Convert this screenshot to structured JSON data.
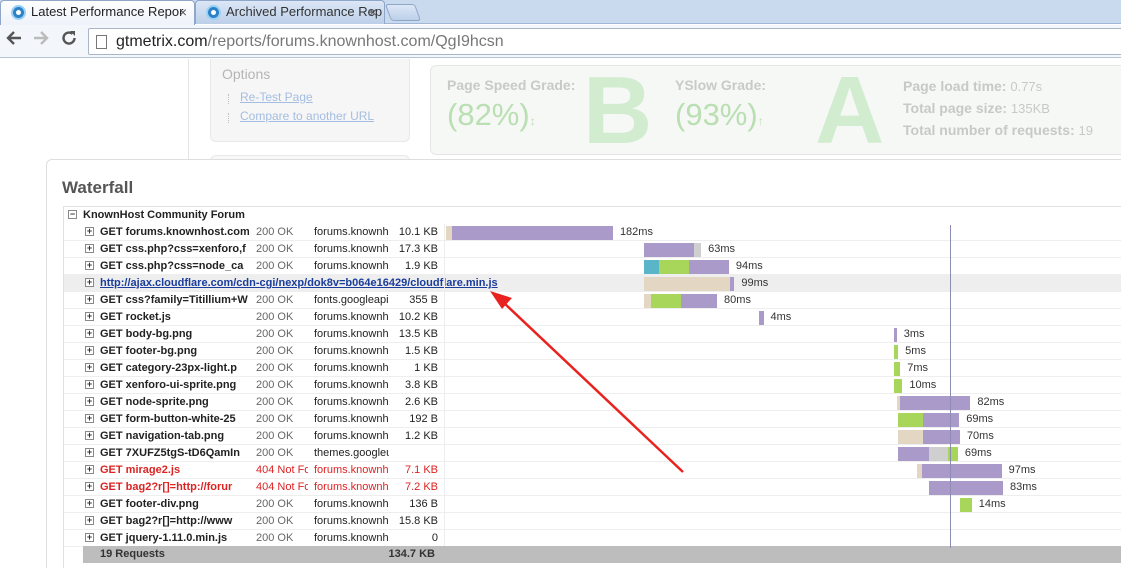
{
  "browser": {
    "tabs": [
      {
        "title": "Latest Performance Repor",
        "close": "×"
      },
      {
        "title": "Archived Performance Rep",
        "close": "×"
      }
    ],
    "url_domain": "gtmetrix.com",
    "url_path": "/reports/forums.knownhost.com/QgI9hcsn"
  },
  "options": {
    "title": "Options",
    "links": [
      "Re-Test Page",
      "Compare to another URL"
    ]
  },
  "grades": {
    "pagespeed": {
      "label": "Page Speed Grade:",
      "percent": "(82%)",
      "arrow": "↕",
      "letter": "B"
    },
    "yslow": {
      "label": "YSlow Grade:",
      "percent": "(93%)",
      "arrow": "↑",
      "letter": "A"
    },
    "stats": [
      {
        "label": "Page load time:",
        "value": "0.77s"
      },
      {
        "label": "Total page size:",
        "value": "135KB"
      },
      {
        "label": "Total number of requests:",
        "value": "19"
      }
    ]
  },
  "waterfall": {
    "title": "Waterfall",
    "group_label": "KnownHost Community Forum",
    "group_toggle": "−",
    "row_toggle": "+",
    "rows": [
      {
        "url": "GET forums.knownhost.com",
        "status": "200 OK",
        "domain": "forums.knownh",
        "size": "10.1 KB",
        "time": "182ms",
        "start": 0.001,
        "segs": [
          {
            "w": 0.009,
            "c": "#e3d7c4"
          },
          {
            "w": 0.232,
            "c": "#a99ac9"
          }
        ]
      },
      {
        "url": "GET css.php?css=xenforo,f",
        "status": "200 OK",
        "domain": "forums.knownh",
        "size": "17.3 KB",
        "time": "63ms",
        "start": 0.287,
        "segs": [
          {
            "w": 0.072,
            "c": "#a99ac9"
          },
          {
            "w": 0.01,
            "c": "#cfcfcf"
          }
        ]
      },
      {
        "url": "GET css.php?css=node_ca",
        "status": "200 OK",
        "domain": "forums.knownh",
        "size": "1.9 KB",
        "time": "94ms",
        "start": 0.287,
        "segs": [
          {
            "w": 0.021,
            "c": "#5ab5c9"
          },
          {
            "w": 0.043,
            "c": "#a8d65a"
          },
          {
            "w": 0.058,
            "c": "#a99ac9"
          }
        ]
      },
      {
        "url": "http://ajax.cloudflare.com/cdn-cgi/nexp/dok8v=b064e16429/cloudflare.min.js",
        "status": "",
        "domain": "",
        "size": "",
        "time": "99ms",
        "start": 0.287,
        "link": true,
        "highlight": true,
        "segs": [
          {
            "w": 0.124,
            "c": "#e3d7c4"
          },
          {
            "w": 0.006,
            "c": "#a99ac9"
          }
        ]
      },
      {
        "url": "GET css?family=Titillium+W",
        "status": "200 OK",
        "domain": "fonts.googleapi",
        "size": "355 B",
        "time": "80ms",
        "start": 0.287,
        "segs": [
          {
            "w": 0.01,
            "c": "#e3d7c4"
          },
          {
            "w": 0.043,
            "c": "#a8d65a"
          },
          {
            "w": 0.052,
            "c": "#a99ac9"
          }
        ]
      },
      {
        "url": "GET rocket.js",
        "status": "200 OK",
        "domain": "forums.knownh",
        "size": "10.2 KB",
        "time": "4ms",
        "start": 0.453,
        "segs": [
          {
            "w": 0.006,
            "c": "#a99ac9"
          }
        ]
      },
      {
        "url": "GET body-bg.png",
        "status": "200 OK",
        "domain": "forums.knownh",
        "size": "13.5 KB",
        "time": "3ms",
        "start": 0.647,
        "segs": [
          {
            "w": 0.004,
            "c": "#a99ac9"
          }
        ]
      },
      {
        "url": "GET footer-bg.png",
        "status": "200 OK",
        "domain": "forums.knownh",
        "size": "1.5 KB",
        "time": "5ms",
        "start": 0.647,
        "segs": [
          {
            "w": 0.006,
            "c": "#a8d65a"
          }
        ]
      },
      {
        "url": "GET category-23px-light.p",
        "status": "200 OK",
        "domain": "forums.knownh",
        "size": "1 KB",
        "time": "7ms",
        "start": 0.647,
        "segs": [
          {
            "w": 0.009,
            "c": "#a8d65a"
          }
        ]
      },
      {
        "url": "GET xenforo-ui-sprite.png",
        "status": "200 OK",
        "domain": "forums.knownh",
        "size": "3.8 KB",
        "time": "10ms",
        "start": 0.647,
        "segs": [
          {
            "w": 0.012,
            "c": "#a8d65a"
          }
        ]
      },
      {
        "url": "GET node-sprite.png",
        "status": "200 OK",
        "domain": "forums.knownh",
        "size": "2.6 KB",
        "time": "82ms",
        "start": 0.651,
        "segs": [
          {
            "w": 0.004,
            "c": "#e3d7c4"
          },
          {
            "w": 0.102,
            "c": "#a99ac9"
          }
        ]
      },
      {
        "url": "GET form-button-white-25",
        "status": "200 OK",
        "domain": "forums.knownh",
        "size": "192 B",
        "time": "69ms",
        "start": 0.653,
        "segs": [
          {
            "w": 0.036,
            "c": "#a8d65a"
          },
          {
            "w": 0.052,
            "c": "#a99ac9"
          }
        ]
      },
      {
        "url": "GET navigation-tab.png",
        "status": "200 OK",
        "domain": "forums.knownh",
        "size": "1.2 KB",
        "time": "70ms",
        "start": 0.653,
        "segs": [
          {
            "w": 0.036,
            "c": "#e3d7c4"
          },
          {
            "w": 0.053,
            "c": "#a99ac9"
          }
        ]
      },
      {
        "url": "GET 7XUFZ5tgS-tD6QamIn",
        "status": "200 OK",
        "domain": "themes.googleu",
        "size": "",
        "time": "69ms",
        "start": 0.653,
        "segs": [
          {
            "w": 0.045,
            "c": "#a99ac9"
          },
          {
            "w": 0.027,
            "c": "#cfcfcf"
          },
          {
            "w": 0.014,
            "c": "#a8d65a"
          }
        ]
      },
      {
        "url": "GET mirage2.js",
        "status": "404 Not Fo",
        "domain": "forums.knownh",
        "size": "7.1 KB",
        "time": "97ms",
        "start": 0.68,
        "error": true,
        "segs": [
          {
            "w": 0.007,
            "c": "#e3d7c4"
          },
          {
            "w": 0.115,
            "c": "#a99ac9"
          }
        ]
      },
      {
        "url": "GET bag2?r[]=http://forur",
        "status": "404 Not Fo",
        "domain": "forums.knownh",
        "size": "7.2 KB",
        "time": "83ms",
        "start": 0.698,
        "error": true,
        "segs": [
          {
            "w": 0.106,
            "c": "#a99ac9"
          }
        ]
      },
      {
        "url": "GET footer-div.png",
        "status": "200 OK",
        "domain": "forums.knownh",
        "size": "136 B",
        "time": "14ms",
        "start": 0.742,
        "segs": [
          {
            "w": 0.017,
            "c": "#a8d65a"
          }
        ]
      },
      {
        "url": "GET bag2?r[]=http://www",
        "status": "200 OK",
        "domain": "forums.knownh",
        "size": "15.8 KB",
        "time": "",
        "start": 0,
        "segs": []
      },
      {
        "url": "GET jquery-1.11.0.min.js",
        "status": "200 OK",
        "domain": "forums.knownh",
        "size": "0",
        "time": "",
        "start": 0,
        "segs": []
      }
    ],
    "summary": {
      "label": "19 Requests",
      "size": "134.7 KB"
    }
  }
}
